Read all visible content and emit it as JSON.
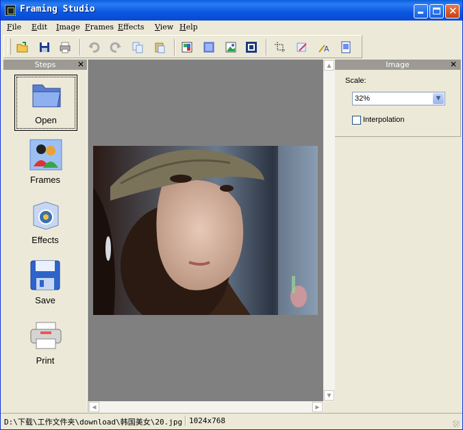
{
  "window": {
    "title": "Framing Studio"
  },
  "menu": [
    "File",
    "Edit",
    "Image",
    "Frames",
    "Effects",
    "View",
    "Help"
  ],
  "toolbar": {
    "icons": [
      "open-folder-icon",
      "save-icon",
      "print-icon",
      "undo-icon",
      "redo-icon",
      "copy-icon",
      "paste-icon",
      "frame-icon",
      "blue-square-icon",
      "picture-icon",
      "border-icon",
      "crop-icon",
      "edit-image-icon",
      "text-icon",
      "page-icon"
    ]
  },
  "steps_panel": {
    "title": "Steps",
    "items": [
      {
        "label": "Open",
        "icon": "folder-icon"
      },
      {
        "label": "Frames",
        "icon": "people-icon"
      },
      {
        "label": "Effects",
        "icon": "effects-box-icon"
      },
      {
        "label": "Save",
        "icon": "floppy-disk-icon"
      },
      {
        "label": "Print",
        "icon": "printer-icon"
      }
    ]
  },
  "image_panel": {
    "title": "Image",
    "scale_label": "Scale:",
    "scale_value": "32%",
    "interpolation_label": "Interpolation",
    "interpolation_checked": false
  },
  "status": {
    "path": "D:\\下载\\工作文件夹\\download\\韩国美女\\20.jpg",
    "size": "1024x768"
  },
  "colors": {
    "title_bar": "#0a5fdc",
    "canvas": "#808080",
    "panel_header": "#9c9a93",
    "face": "#ece9d8"
  }
}
